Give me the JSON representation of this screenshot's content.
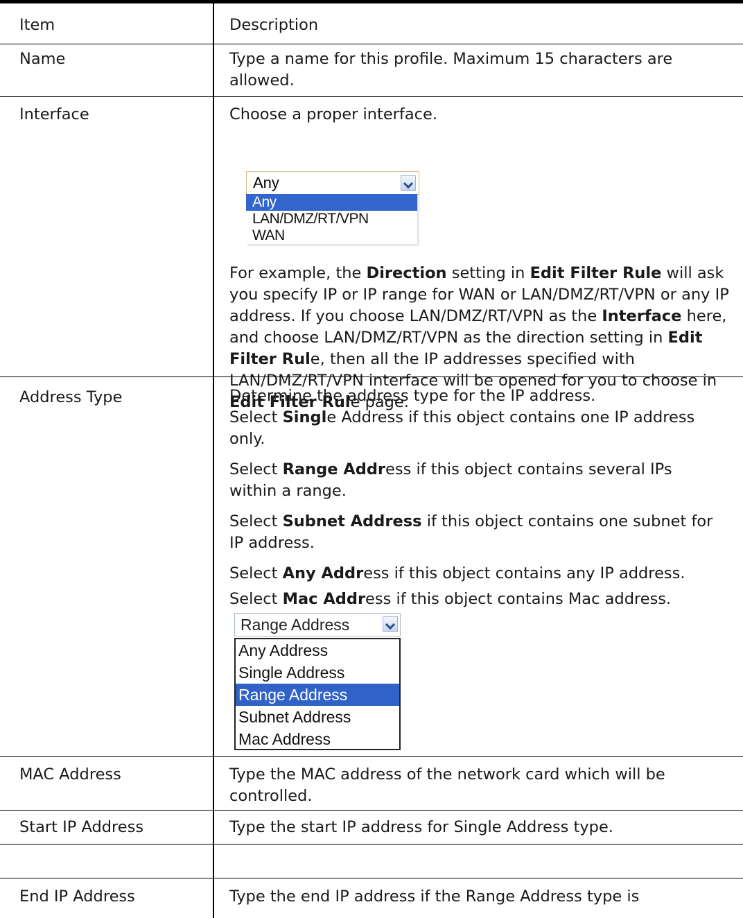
{
  "table": {
    "header": {
      "item": "Item",
      "description": "Description"
    },
    "rows": {
      "name": {
        "item": "Name",
        "desc": "Type a name for this profile. Maximum 15 characters are allowed."
      },
      "interface": {
        "item": "Interface",
        "desc_intro": "Choose a proper interface.",
        "p1": "For example, the ",
        "b1": "Direction",
        "p2": " setting in ",
        "b2": "Edit Filter Rule",
        "p3": " will ask you specify IP or IP range for WAN or LAN/DMZ/RT/VPN or any IP address. If you choose LAN/DMZ/RT/VPN as the ",
        "b3": "Interface",
        "p4": " here, and choose LAN/DMZ/RT/VPN as the direction setting in ",
        "b4": "Edit Filter Rul",
        "p5": "e, then all the IP addresses specified with LAN/DMZ/RT/VPN interface will be opened for you to choose in ",
        "b5": "Edit Filter Rul",
        "p6": "e page."
      },
      "address_type": {
        "item": "Address Type",
        "line1": "Determine the address type for the IP address.",
        "s1_pre": "Select ",
        "s1_b": "Singl",
        "s1_post": "e Address if this object contains one IP address only.",
        "s2_pre": "Select ",
        "s2_b": "Range Addr",
        "s2_post": "ess if this object contains several IPs within a range.",
        "s3_pre": "Select ",
        "s3_b": "Subnet Address",
        "s3_post": " if this object contains one subnet for IP address.",
        "s4_pre": "Select ",
        "s4_b": "Any Addr",
        "s4_post": "ess if this object contains any IP address.",
        "s5_pre": "Select ",
        "s5_b": "Mac Addr",
        "s5_post": "ess if this object contains Mac address."
      },
      "mac": {
        "item": "MAC Address",
        "desc": "Type the MAC address of the network card which will be controlled."
      },
      "start_ip": {
        "item": "Start IP Address",
        "desc": "Type the start IP address for Single Address type."
      },
      "end_ip": {
        "item": "End IP Address",
        "desc": "Type the end IP address if the Range Address type is"
      }
    }
  },
  "interface_dropdown": {
    "selected": "Any",
    "options": [
      "Any",
      "LAN/DMZ/RT/VPN",
      "WAN"
    ]
  },
  "address_dropdown": {
    "selected": "Range Address",
    "options": [
      "Any Address",
      "Single Address",
      "Range Address",
      "Subnet Address",
      "Mac Address"
    ]
  },
  "colors": {
    "selection": "#3366cc",
    "border": "#000000"
  }
}
